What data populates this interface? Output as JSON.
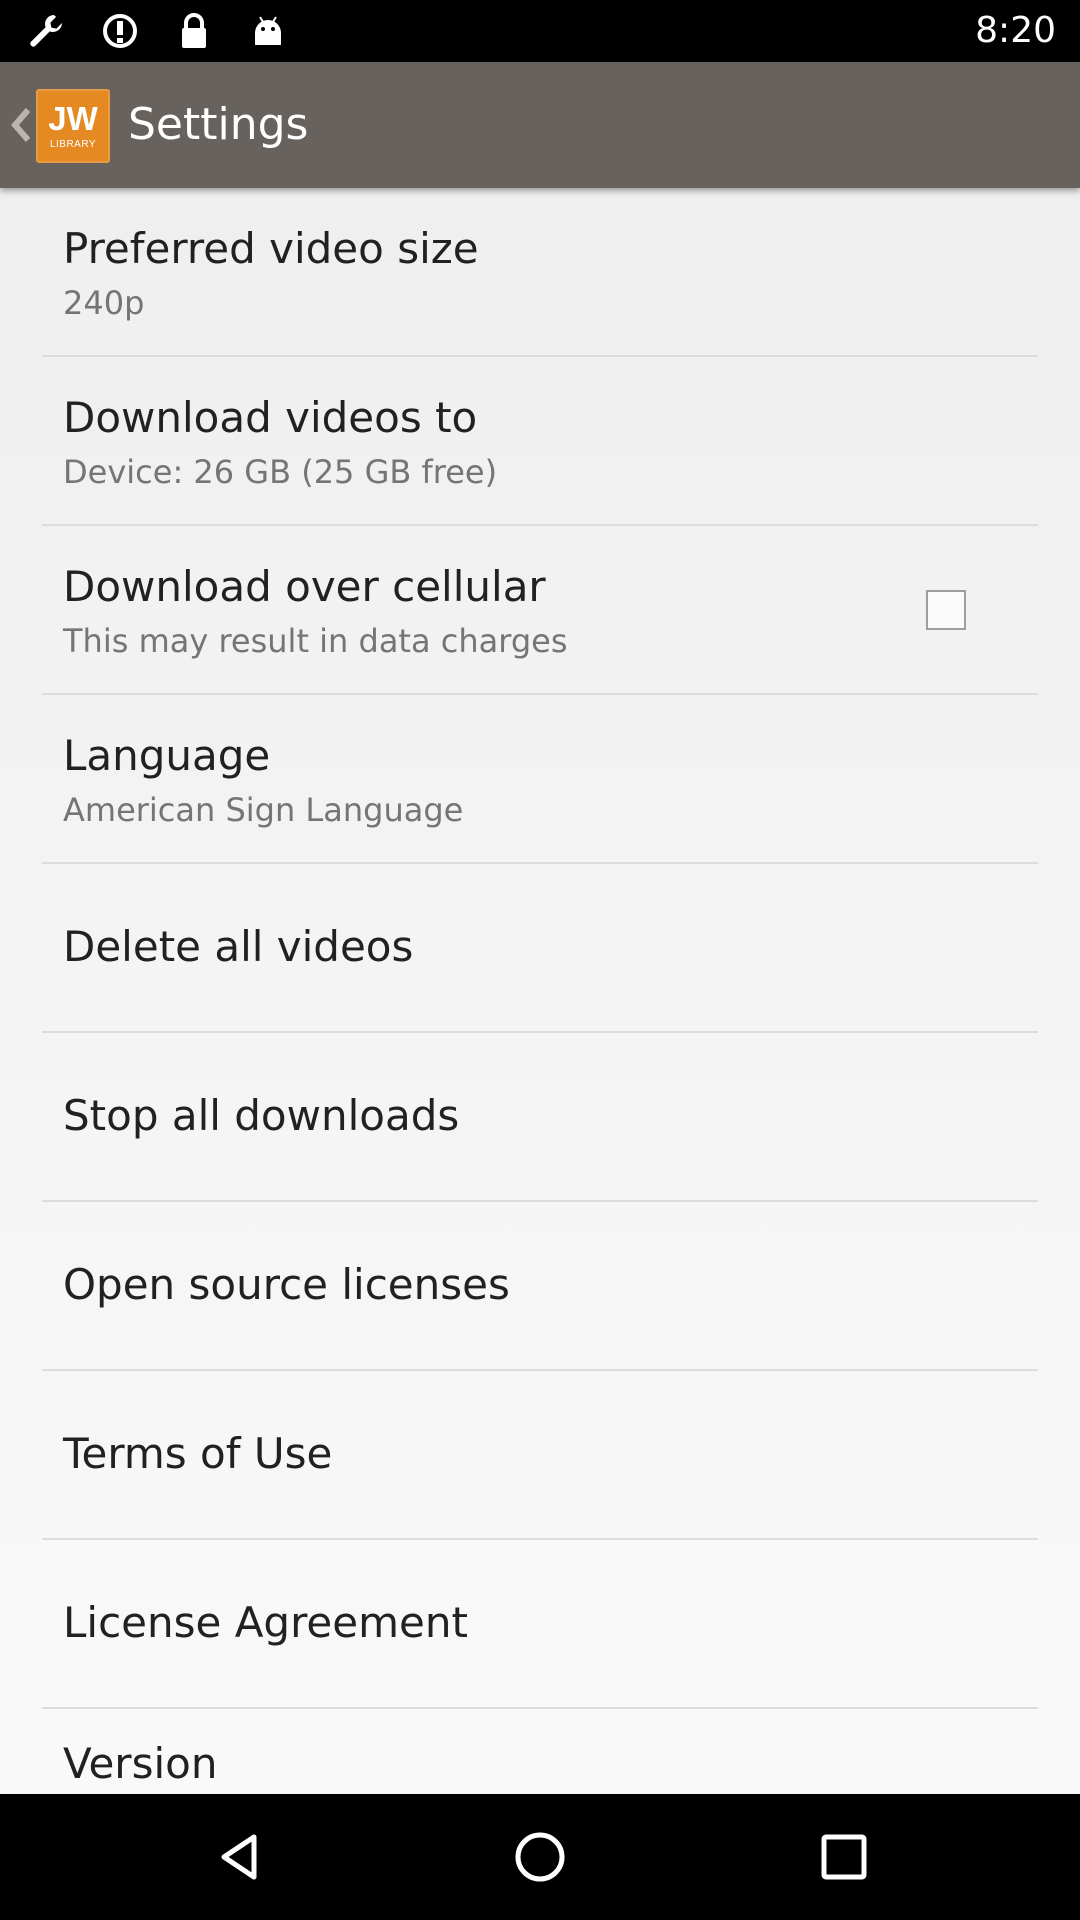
{
  "status_bar": {
    "time": "8:20",
    "left_icons": [
      "wrench-icon",
      "sync-icon",
      "lock-icon",
      "android-icon"
    ]
  },
  "app_bar": {
    "logo_main": "JW",
    "logo_sub": "LIBRARY",
    "title": "Settings"
  },
  "settings": {
    "items": [
      {
        "title": "Preferred video size",
        "summary": "240p"
      },
      {
        "title": "Download videos to",
        "summary": "Device: 26 GB (25 GB free)"
      },
      {
        "title": "Download over cellular",
        "summary": "This may result in data charges",
        "checked": false
      },
      {
        "title": "Language",
        "summary": "American Sign Language"
      },
      {
        "title": "Delete all videos"
      },
      {
        "title": "Stop all downloads"
      },
      {
        "title": "Open source licenses"
      },
      {
        "title": "Terms of Use"
      },
      {
        "title": "License Agreement"
      },
      {
        "title": "Version"
      }
    ]
  },
  "nav_bar": {
    "buttons": [
      "back-icon",
      "home-icon",
      "recents-icon"
    ]
  },
  "colors": {
    "app_bar": "#67625d",
    "logo": "#e58a23",
    "list_background": "#f2f2f2"
  }
}
